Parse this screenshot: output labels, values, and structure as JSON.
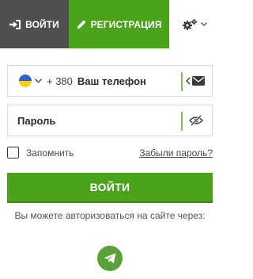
{
  "tabs": {
    "login_label": "ВОЙТИ",
    "register_label": "РЕГИСТРАЦИЯ",
    "settings_icon": "gears-icon"
  },
  "phone": {
    "country_flag": "ukraine-flag",
    "country_code": "+ 380",
    "placeholder": "Ваш телефон",
    "switch_icon": "envelope-icon"
  },
  "password": {
    "placeholder": "Пароль",
    "visibility_icon": "eye-slash-icon"
  },
  "remember": {
    "label": "Запомнить",
    "checked": false
  },
  "forgot_link": "Забыли пароль?",
  "submit_label": "ВОЙТИ",
  "social_note": "Вы можете авторизоваться на сайте через:",
  "social": {
    "telegram_icon": "telegram-icon"
  },
  "colors": {
    "brand_green": "#4ba21b",
    "dark_tab": "#4f4f4f"
  }
}
